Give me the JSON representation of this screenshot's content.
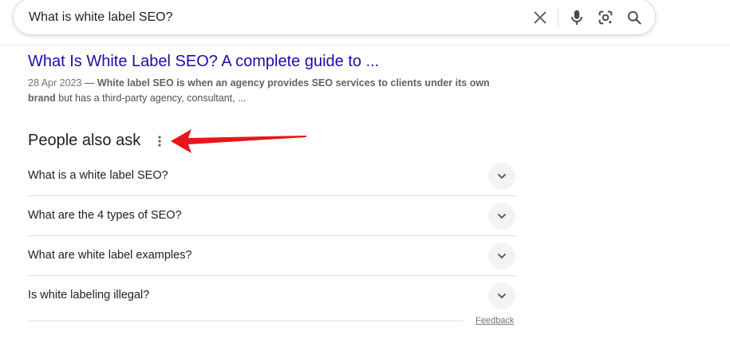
{
  "search": {
    "query": "What is white label SEO?"
  },
  "result": {
    "title": "What Is White Label SEO? A complete guide to ...",
    "date": "28 Apr 2023",
    "separator": " — ",
    "snippet_bold": "White label SEO is when an agency provides SEO services to clients under its own brand",
    "snippet_rest": " but has a third-party agency, consultant, ..."
  },
  "paa": {
    "heading": "People also ask",
    "questions": [
      "What is a white label SEO?",
      "What are the 4 types of SEO?",
      "What are white label examples?",
      "Is white labeling illegal?"
    ],
    "feedback_label": "Feedback"
  },
  "colors": {
    "link": "#1a0dab",
    "arrow": "#e8161b",
    "chevron_bg": "#f1f3f4"
  },
  "icons": {
    "clear": "close-icon",
    "mic": "microphone-icon",
    "lens": "google-lens-icon",
    "search": "search-icon",
    "menu": "more-vert-icon",
    "expand": "chevron-down-icon"
  }
}
